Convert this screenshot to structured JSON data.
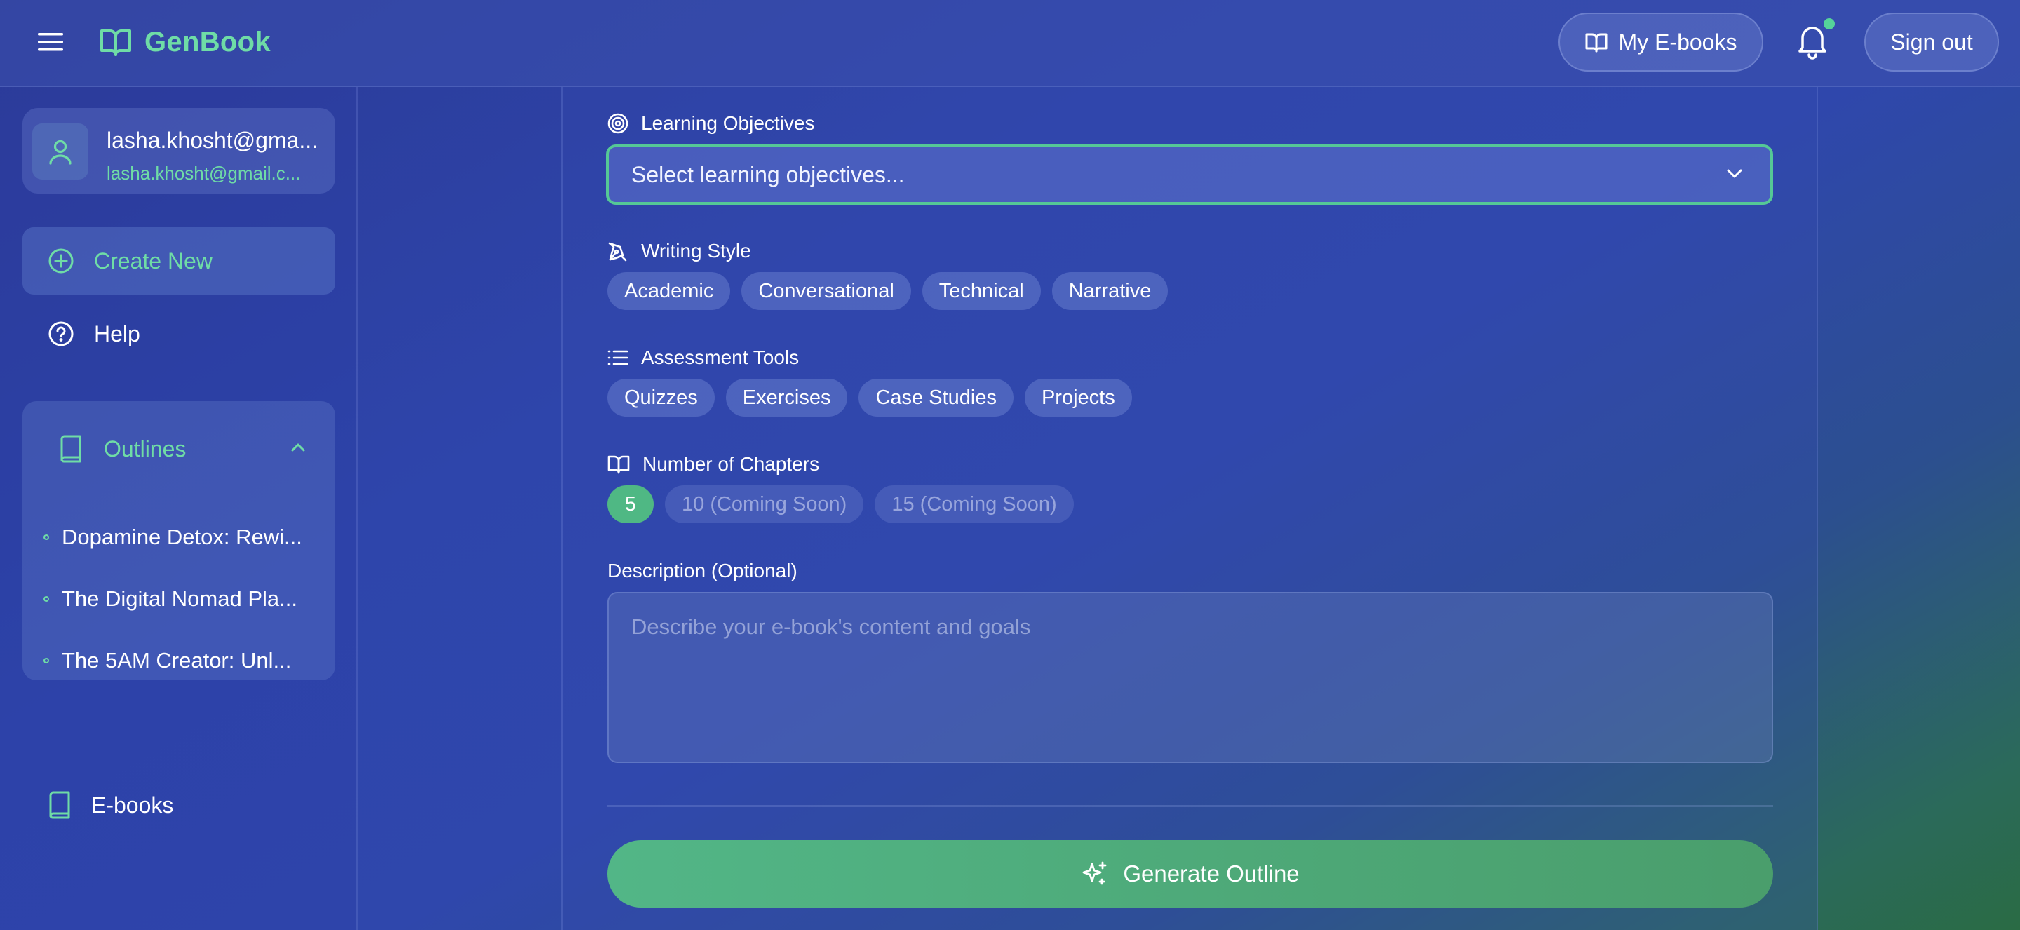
{
  "header": {
    "brand": "GenBook",
    "my_ebooks_label": "My E-books",
    "sign_out_label": "Sign out",
    "notification_dot_color": "#55d39a"
  },
  "sidebar": {
    "user": {
      "name": "lasha.khosht@gma...",
      "email": "lasha.khosht@gmail.c..."
    },
    "create_new_label": "Create New",
    "help_label": "Help",
    "outlines": {
      "title": "Outlines",
      "items": [
        "Dopamine Detox: Rewi...",
        "The Digital Nomad Pla...",
        "The 5AM Creator: Unl..."
      ]
    },
    "ebooks_label": "E-books"
  },
  "form": {
    "learning_objectives": {
      "label": "Learning Objectives",
      "placeholder": "Select learning objectives..."
    },
    "writing_style": {
      "label": "Writing Style",
      "options": [
        "Academic",
        "Conversational",
        "Technical",
        "Narrative"
      ]
    },
    "assessment_tools": {
      "label": "Assessment Tools",
      "options": [
        "Quizzes",
        "Exercises",
        "Case Studies",
        "Projects"
      ]
    },
    "chapters": {
      "label": "Number of Chapters",
      "selected": "5",
      "options": [
        "5",
        "10 (Coming Soon)",
        "15 (Coming Soon)"
      ]
    },
    "description": {
      "label": "Description (Optional)",
      "placeholder": "Describe your e-book's content and goals"
    },
    "generate_label": "Generate Outline"
  },
  "colors": {
    "accent": "#6fdca6",
    "button": "#52b687",
    "select_border": "#55c896"
  }
}
